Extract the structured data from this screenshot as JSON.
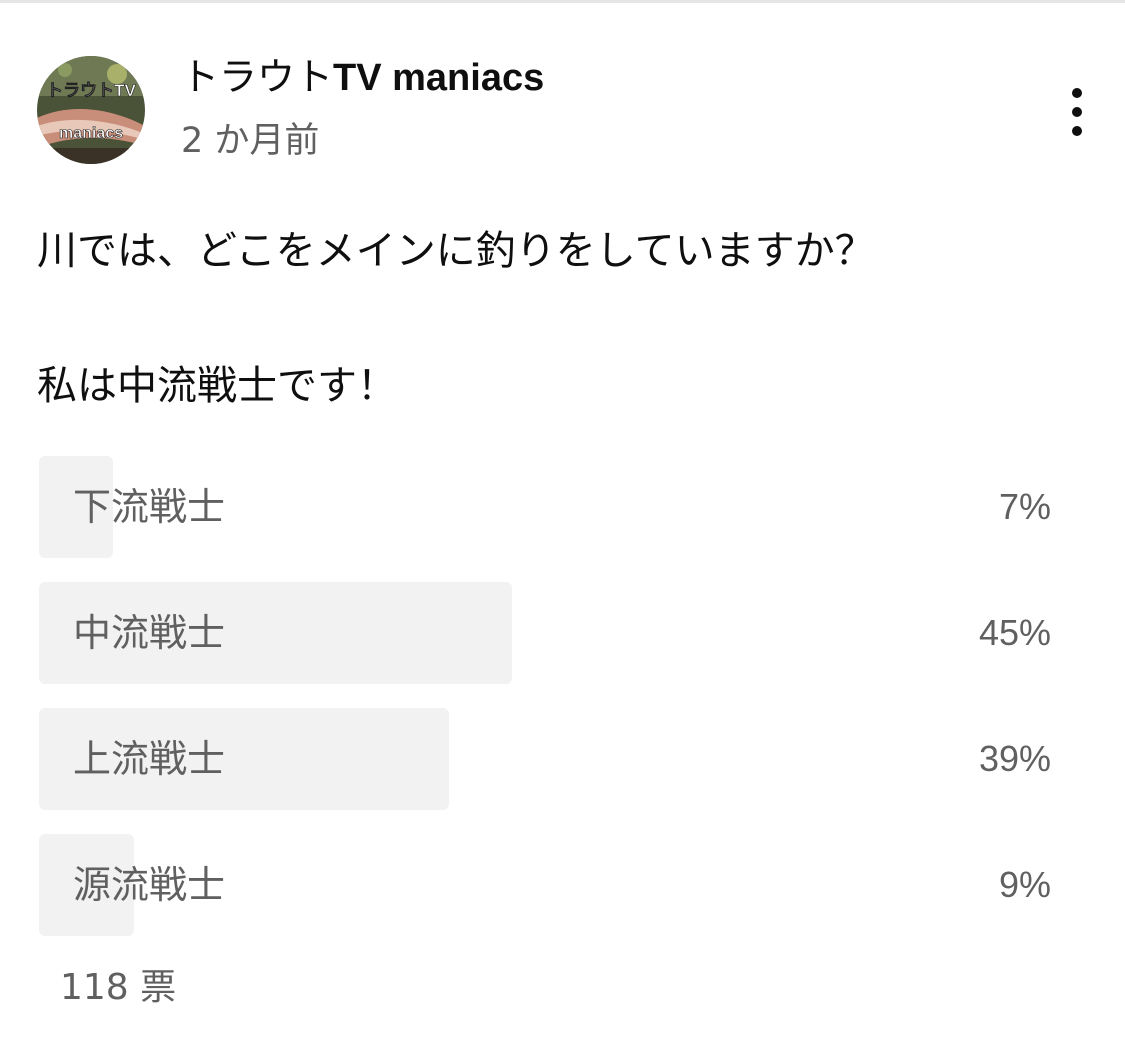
{
  "post": {
    "channel_name_jp": "トラウト",
    "channel_name_latin": "TV maniacs",
    "time_ago": "2 か月前",
    "avatar_text_top": "トラウトTV",
    "avatar_text_bottom": "maniacs",
    "menu_icon": "more-vert-icon",
    "text_line1": "川では、どこをメインに釣りをしていますか？",
    "text_line2": "私は中流戦士です！"
  },
  "poll": {
    "options": [
      {
        "label": "下流戦士",
        "percent_label": "7%",
        "percent": 7
      },
      {
        "label": "中流戦士",
        "percent_label": "45%",
        "percent": 45
      },
      {
        "label": "上流戦士",
        "percent_label": "39%",
        "percent": 39
      },
      {
        "label": "源流戦士",
        "percent_label": "9%",
        "percent": 9
      }
    ],
    "vote_count": "118 票"
  },
  "colors": {
    "bar_fill": "#f2f2f2",
    "secondary_text": "#606060",
    "primary_text": "#0f0f0f"
  }
}
